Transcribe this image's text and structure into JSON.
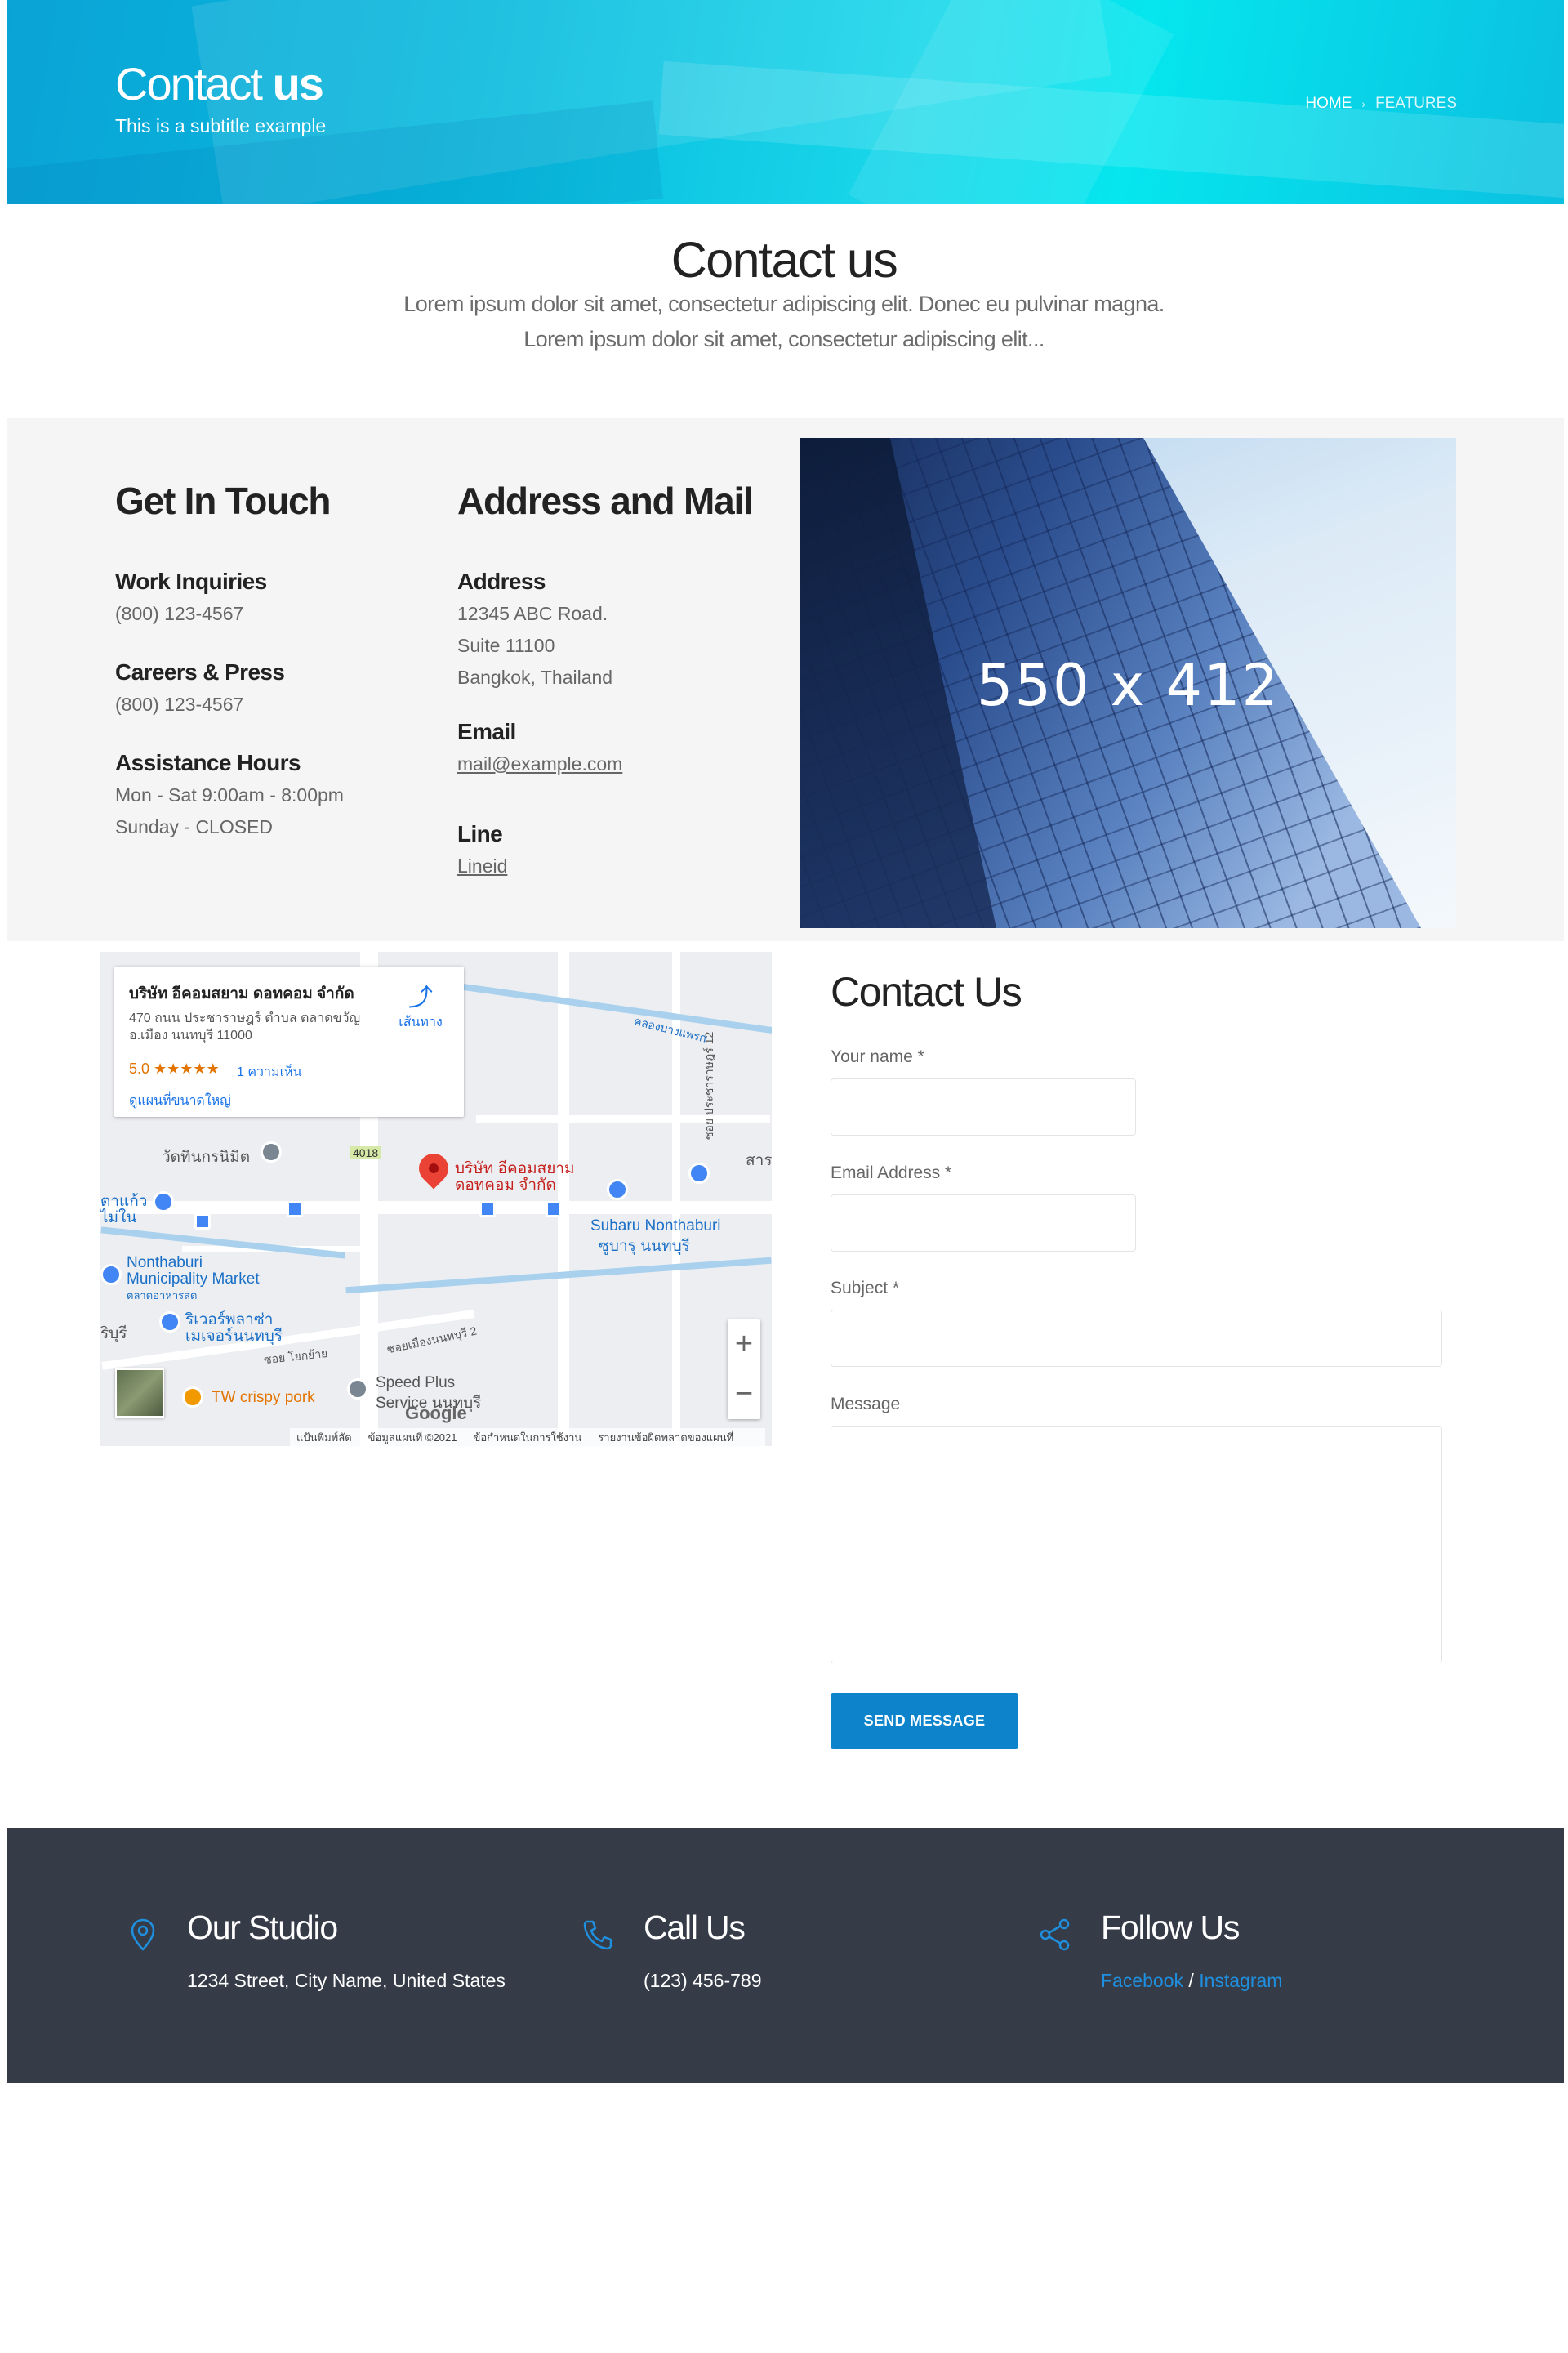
{
  "hero": {
    "title_light": "Contact",
    "title_bold": "us",
    "subtitle": "This is a subtitle example",
    "breadcrumb": [
      "HOME",
      "FEATURES"
    ]
  },
  "intro": {
    "title": "Contact us",
    "line1": "Lorem ipsum dolor sit amet, consectetur adipiscing elit. Donec eu pulvinar magna.",
    "line2": "Lorem ipsum dolor sit amet, consectetur adipiscing elit..."
  },
  "get_in_touch": {
    "heading": "Get In Touch",
    "work_label": "Work Inquiries",
    "work_phone": "(800) 123-4567",
    "careers_label": "Careers & Press",
    "careers_phone": "(800) 123-4567",
    "hours_label": "Assistance Hours",
    "hours_line1": "Mon - Sat 9:00am - 8:00pm",
    "hours_line2": "Sunday - CLOSED"
  },
  "address_mail": {
    "heading": "Address and Mail",
    "address_label": "Address",
    "address_line1": "12345 ABC Road.",
    "address_line2": "Suite 11100",
    "address_line3": "Bangkok, Thailand",
    "email_label": "Email",
    "email": "mail@example.com",
    "line_label": "Line",
    "line_id": "Lineid"
  },
  "image_placeholder": "550 x 412",
  "map": {
    "place_name": "บริษัท อีคอมสยาม ดอทคอม จำกัด",
    "place_address": "470 ถนน ประชาราษฎร์ ตำบล ตลาดขวัญ อ.เมือง นนทบุรี 11000",
    "rating": "5.0 ★★★★★",
    "reviews": "1 ความเห็น",
    "larger_map": "ดูแผนที่ขนาดใหญ่",
    "directions": "เส้นทาง",
    "pin_label_1": "บริษัท อีคอมสยาม",
    "pin_label_2": "ดอทคอม จำกัด",
    "labels": {
      "temple": "วัดทินกรนิมิต",
      "route": "4018",
      "subaru1": "Subaru Nonthaburi",
      "subaru2": "ซูบารุ นนทบุรี",
      "market1": "Nonthaburi",
      "market2": "Municipality Market",
      "market3": "ตลาดอาหารสด",
      "river1": "ริเวอร์พลาซ่า",
      "river2": "เมเจอร์นนทบุรี",
      "tw": "TW crispy pork",
      "speed1": "Speed Plus",
      "speed2": "Service นนทบุรี",
      "canal": "คลองบางแพรก",
      "wat_left1": "ตาแก้ว",
      "wat_left2": "ไม่ใน",
      "left_cut": "ริบุรี",
      "right_cut": "สาร",
      "soi1": "ซอย ประชาราษฎร์ 12",
      "soi2": "ซอยเมืองนนทบุรี 2",
      "soi3": "ซอย โยกย้าย"
    },
    "google": "Google",
    "attribution": [
      "แป้นพิมพ์ลัด",
      "ข้อมูลแผนที่ ©2021",
      "ข้อกำหนดในการใช้งาน",
      "รายงานข้อผิดพลาดของแผนที่"
    ],
    "zoom_in": "+",
    "zoom_out": "−"
  },
  "form": {
    "title": "Contact Us",
    "name_label": "Your name *",
    "email_label": "Email Address *",
    "subject_label": "Subject *",
    "message_label": "Message",
    "submit": "SEND MESSAGE"
  },
  "footer": {
    "studio_title": "Our Studio",
    "studio_text": "1234 Street, City Name, United States",
    "call_title": "Call Us",
    "call_text": "(123) 456-789",
    "follow_title": "Follow Us",
    "facebook": "Facebook",
    "sep": " / ",
    "instagram": "Instagram"
  },
  "colors": {
    "accent": "#0d83cc",
    "footer_bg": "#363c47",
    "link_blue": "#1f8fdf"
  }
}
